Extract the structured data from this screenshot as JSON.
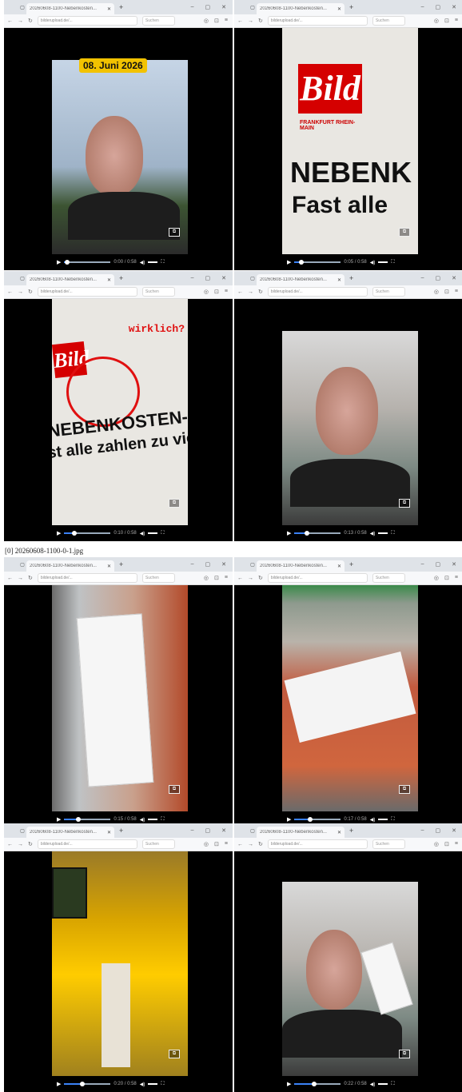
{
  "caption": "[0] 20260608-1100-0-1.jpg",
  "browser": {
    "tab_title": "20260608-1100-Nebenkosten...",
    "search_placeholder": "Suchen",
    "url_text": "bilderupload.de/..."
  },
  "frames": [
    {
      "overlay_date": "08. Juni 2026",
      "time": "0:00 / 0:58"
    },
    {
      "time": "0:05 / 0:58"
    },
    {
      "overlay_text": "wirklich?",
      "headline": "NEBENKOSTEN-FALLE",
      "subline": "st alle zahlen zu viel",
      "time": "0:10 / 0:58"
    },
    {
      "time": "0:13 / 0:58"
    },
    {
      "time": "0:15 / 0:58"
    },
    {
      "time": "0:17 / 0:58"
    },
    {
      "time": "0:20 / 0:58"
    },
    {
      "time": "0:22 / 0:58"
    }
  ],
  "paper": {
    "brand": "Bild",
    "edition": "FRANKFURT RHEIN-MAIN",
    "headline_big": "NEBENK",
    "sub_big": "Fast alle"
  },
  "icons": {
    "play": "play-icon",
    "volume": "volume-icon",
    "fullscreen": "fullscreen-icon",
    "pip": "picture-in-picture-icon"
  }
}
